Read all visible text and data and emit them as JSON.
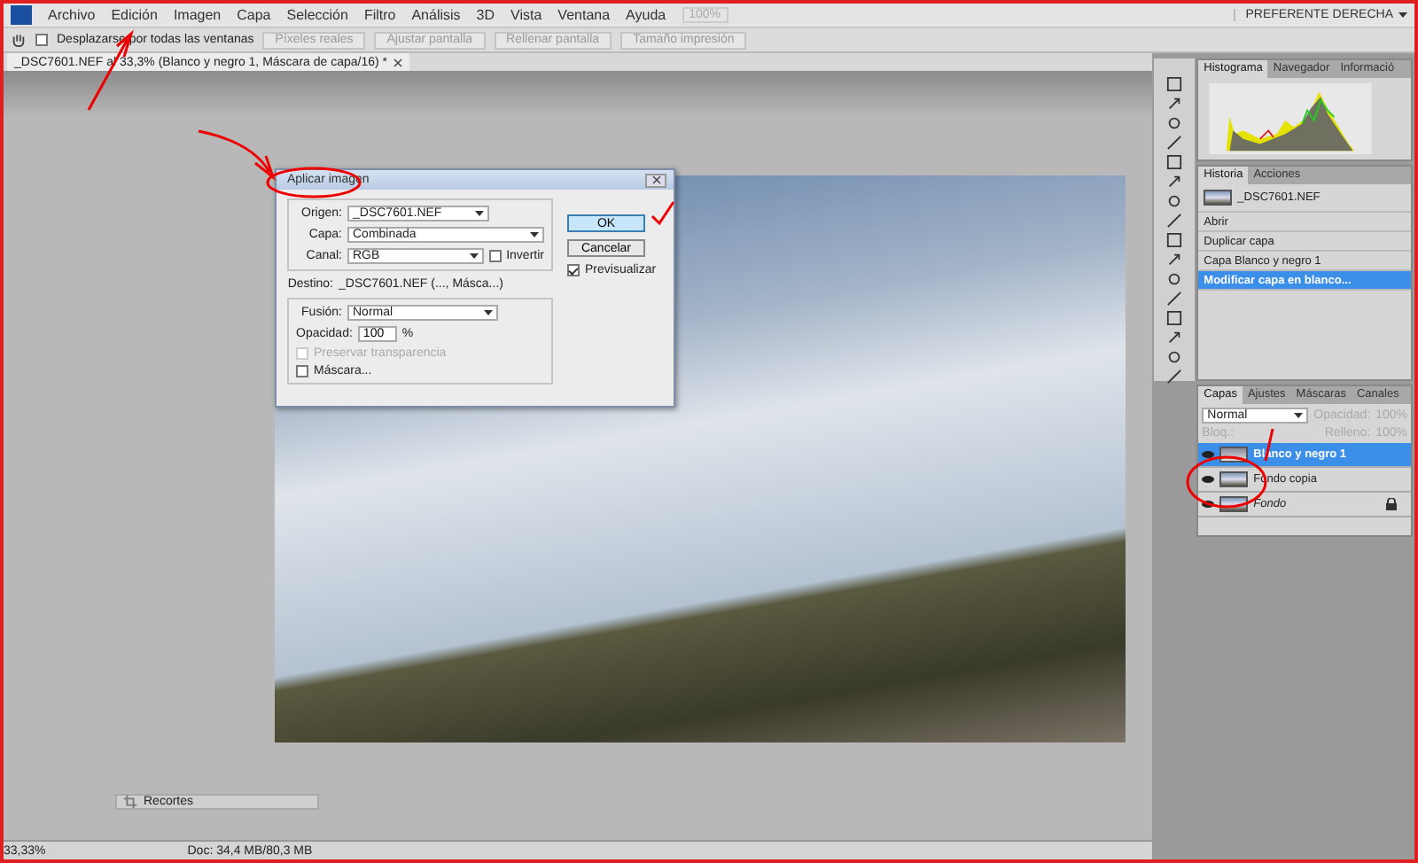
{
  "menu_bar": {
    "items": [
      "Archivo",
      "Edición",
      "Imagen",
      "Capa",
      "Selección",
      "Filtro",
      "Análisis",
      "3D",
      "Vista",
      "Ventana",
      "Ayuda"
    ],
    "zoom": "100%",
    "workspace": "PREFERENTE DERECHA"
  },
  "options_bar": {
    "checkbox": {
      "label": "Desplazarse por todas las ventanas",
      "checked": false
    },
    "buttons": [
      "Píxeles reales",
      "Ajustar pantalla",
      "Rellenar pantalla",
      "Tamaño impresión"
    ]
  },
  "document_tab": {
    "title": "_DSC7601.NEF al 33,3% (Blanco y negro 1, Máscara de capa/16) *"
  },
  "dialog": {
    "title": "Aplicar imagen",
    "origin": {
      "label": "Origen:",
      "value": "_DSC7601.NEF"
    },
    "layer": {
      "label": "Capa:",
      "value": "Combinada"
    },
    "channel": {
      "label": "Canal:",
      "value": "RGB"
    },
    "invert": {
      "label": "Invertir",
      "checked": false
    },
    "destination": {
      "label": "Destino:",
      "value": "_DSC7601.NEF (..., Másca...)"
    },
    "blend": {
      "label": "Fusión:",
      "value": "Normal"
    },
    "opacity": {
      "label": "Opacidad:",
      "value": "100",
      "unit": "%"
    },
    "preserve": {
      "label": "Preservar transparencia",
      "checked": false,
      "disabled": true
    },
    "mask": {
      "label": "Máscara...",
      "checked": false,
      "disabled": false
    },
    "buttons": [
      "OK",
      "Cancelar"
    ],
    "preview": {
      "label": "Previsualizar",
      "checked": true
    }
  },
  "recortes_panel": {
    "title": "Recortes"
  },
  "status_bar": {
    "zoom": "33,33%",
    "doc": "Doc: 34,4 MB/80,3 MB"
  },
  "histogram_panel": {
    "tabs": [
      {
        "label": "Histograma",
        "selected": true
      },
      {
        "label": "Navegador",
        "selected": false
      },
      {
        "label": "Informació",
        "selected": false
      }
    ]
  },
  "history_panel": {
    "tabs": [
      {
        "label": "Historia",
        "selected": true
      },
      {
        "label": "Acciones",
        "selected": false
      }
    ],
    "snapshot": "_DSC7601.NEF",
    "items": [
      {
        "label": "Abrir",
        "selected": false
      },
      {
        "label": "Duplicar capa",
        "selected": false
      },
      {
        "label": "Capa Blanco y negro 1",
        "selected": false
      },
      {
        "label": "Modificar capa en blanco...",
        "selected": true
      }
    ]
  },
  "layers_panel": {
    "tabs": [
      {
        "label": "Capas",
        "selected": true
      },
      {
        "label": "Ajustes",
        "selected": false
      },
      {
        "label": "Máscaras",
        "selected": false
      },
      {
        "label": "Canales",
        "selected": false
      }
    ],
    "blend": "Normal",
    "opacity_label": "Opacidad:",
    "opacity": "100%",
    "lock_label": "Bloq.:",
    "fill_label": "Relleno:",
    "fill": "100%",
    "layers": [
      {
        "name": "Blanco y negro 1",
        "selected": true,
        "kind": "adjustment"
      },
      {
        "name": "Fondo copia",
        "selected": false,
        "kind": "image"
      },
      {
        "name": "Fondo",
        "selected": false,
        "kind": "background"
      }
    ]
  }
}
